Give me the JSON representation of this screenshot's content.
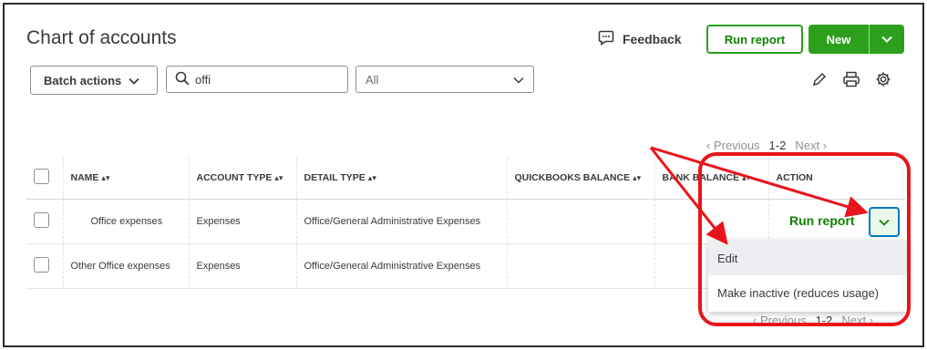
{
  "page": {
    "title": "Chart of accounts",
    "feedback_label": "Feedback",
    "run_report_label": "Run report",
    "new_label": "New"
  },
  "toolbar": {
    "batch_actions_label": "Batch actions",
    "search_value": "offi",
    "filter_value": "All",
    "icons": [
      "pencil-icon",
      "print-icon",
      "gear-icon"
    ]
  },
  "pagination": {
    "previous": "Previous",
    "range": "1-2",
    "next": "Next"
  },
  "table": {
    "columns": [
      "NAME",
      "ACCOUNT TYPE",
      "DETAIL TYPE",
      "QUICKBOOKS BALANCE",
      "BANK BALANCE",
      "ACTION"
    ],
    "rows": [
      {
        "name": "Office expenses",
        "account_type": "Expenses",
        "detail_type": "Office/General Administrative Expenses",
        "quickbooks_balance": "",
        "bank_balance": ""
      },
      {
        "name": "Other Office expenses",
        "account_type": "Expenses",
        "detail_type": "Office/General Administrative Expenses",
        "quickbooks_balance": "",
        "bank_balance": ""
      }
    ],
    "row_action_label": "Run report"
  },
  "dropdown_menu": {
    "items": [
      "Edit",
      "Make inactive (reduces usage)"
    ]
  },
  "annotation": {
    "color": "#e8141c"
  },
  "colors": {
    "brand_green": "#2ca01c",
    "focus_blue": "#0077c5"
  }
}
